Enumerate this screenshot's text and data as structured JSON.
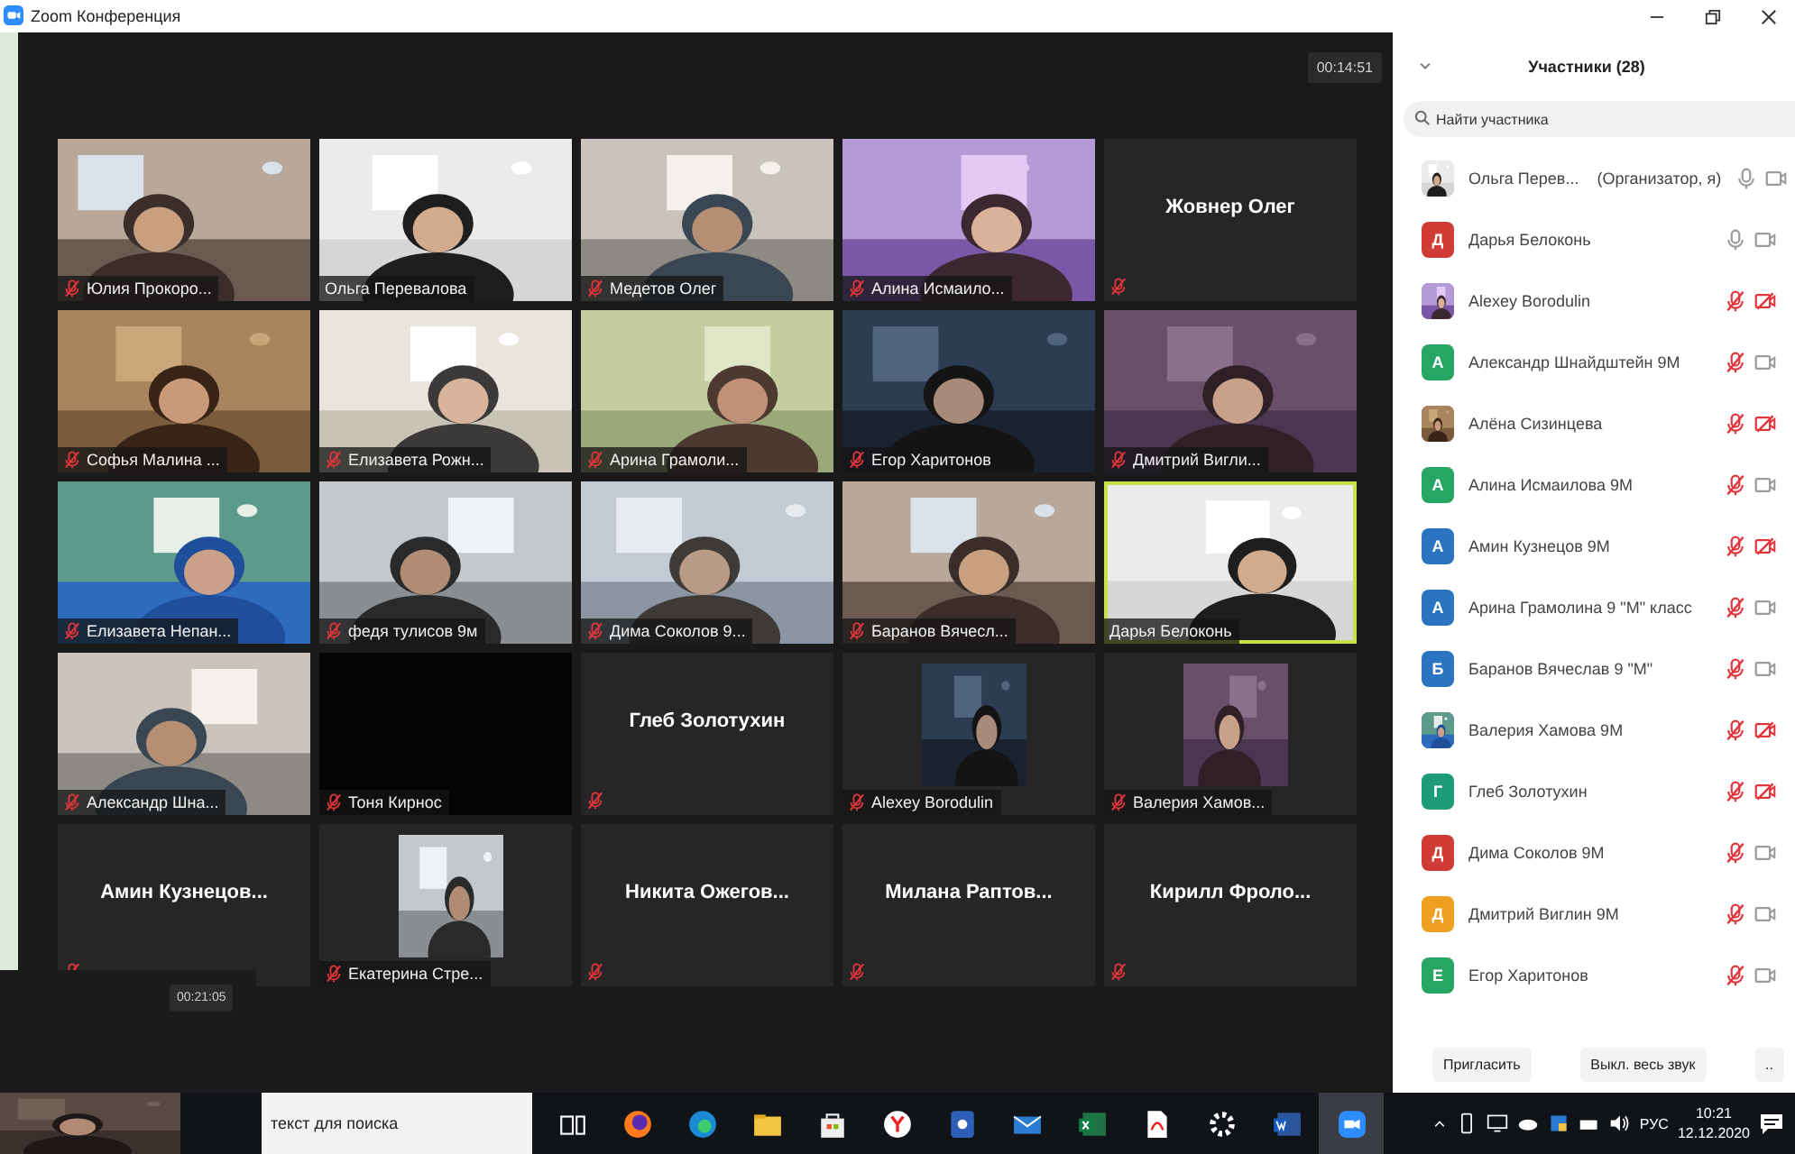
{
  "window": {
    "title": "Zoom Конференция"
  },
  "meeting_timer": "00:14:51",
  "tiles": [
    {
      "name": "Юлия Прокоро...",
      "kind": "video",
      "muted": true,
      "active": false
    },
    {
      "name": "Ольга Перевалова",
      "kind": "video",
      "muted": false,
      "active": false
    },
    {
      "name": "Медетов Олег",
      "kind": "video",
      "muted": true,
      "active": false
    },
    {
      "name": "Алина Исмаило...",
      "kind": "video",
      "muted": true,
      "active": false
    },
    {
      "name": "Жовнер Олег",
      "kind": "name_only",
      "muted": true,
      "active": false
    },
    {
      "name": "Софья Малина ...",
      "kind": "video",
      "muted": true,
      "active": false
    },
    {
      "name": "Елизавета Рожн...",
      "kind": "video",
      "muted": true,
      "active": false
    },
    {
      "name": "Арина Грамоли...",
      "kind": "video",
      "muted": true,
      "active": false
    },
    {
      "name": "Егор Харитонов",
      "kind": "video",
      "muted": true,
      "active": false
    },
    {
      "name": "Дмитрий Вигли...",
      "kind": "video",
      "muted": true,
      "active": false
    },
    {
      "name": "Елизавета Непан...",
      "kind": "video",
      "muted": true,
      "active": false
    },
    {
      "name": "федя тулисов 9м",
      "kind": "video",
      "muted": true,
      "active": false
    },
    {
      "name": "Дима Соколов 9...",
      "kind": "video",
      "muted": true,
      "active": false
    },
    {
      "name": "Баранов Вячесл...",
      "kind": "video",
      "muted": true,
      "active": false
    },
    {
      "name": "Дарья Белоконь",
      "kind": "video",
      "muted": false,
      "active": true
    },
    {
      "name": "Александр Шна...",
      "kind": "video",
      "muted": true,
      "active": false
    },
    {
      "name": "Тоня Кирнос",
      "kind": "dark",
      "muted": true,
      "active": false
    },
    {
      "name": "Глеб Золотухин",
      "kind": "name_only",
      "muted": true,
      "active": false
    },
    {
      "name": "Alexey Borodulin",
      "kind": "avatar",
      "muted": true,
      "active": false
    },
    {
      "name": "Валерия Хамов...",
      "kind": "avatar",
      "muted": true,
      "active": false
    },
    {
      "name": "Амин Кузнецов...",
      "kind": "name_only",
      "muted": true,
      "active": false
    },
    {
      "name": "Екатерина Стре...",
      "kind": "avatar",
      "muted": true,
      "active": false
    },
    {
      "name": "Никита Ожегов...",
      "kind": "name_only",
      "muted": true,
      "active": false
    },
    {
      "name": "Милана Раптов...",
      "kind": "name_only",
      "muted": true,
      "active": false
    },
    {
      "name": "Кирилл Фроло...",
      "kind": "name_only",
      "muted": true,
      "active": false
    }
  ],
  "second_window": {
    "timer": "00:21:05"
  },
  "participants_panel": {
    "title": "Участники (28)",
    "search": {
      "placeholder": "Найти участника"
    },
    "participants": [
      {
        "name": "Ольга Перев...",
        "role": "(Организатор, я)",
        "muted": false,
        "video_off": false
      },
      {
        "name": "Дарья Белоконь",
        "avatar": {
          "kind": "letter",
          "letter": "Д",
          "color": "#d13b35"
        },
        "muted": false,
        "video_off": false
      },
      {
        "name": "Alexey Borodulin",
        "muted": true,
        "video_off": true
      },
      {
        "name": "Александр Шнайдштейн 9М",
        "avatar": {
          "kind": "letter",
          "letter": "А",
          "color": "#27a563"
        },
        "muted": true,
        "video_off": false
      },
      {
        "name": "Алёна Сизинцева",
        "muted": true,
        "video_off": true
      },
      {
        "name": "Алина Исмаилова 9М",
        "avatar": {
          "kind": "letter",
          "letter": "А",
          "color": "#27a563"
        },
        "muted": true,
        "video_off": false
      },
      {
        "name": "Амин Кузнецов 9М",
        "avatar": {
          "kind": "letter",
          "letter": "А",
          "color": "#2b74c2"
        },
        "muted": true,
        "video_off": true
      },
      {
        "name": "Арина Грамолина 9 \"М\" класс",
        "avatar": {
          "kind": "letter",
          "letter": "А",
          "color": "#2b74c2"
        },
        "muted": true,
        "video_off": false
      },
      {
        "name": "Баранов Вячеслав 9 \"М\"",
        "avatar": {
          "kind": "letter",
          "letter": "Б",
          "color": "#2b74c2"
        },
        "muted": true,
        "video_off": false
      },
      {
        "name": "Валерия Хамова 9М",
        "muted": true,
        "video_off": true
      },
      {
        "name": "Глеб Золотухин",
        "avatar": {
          "kind": "letter",
          "letter": "Г",
          "color": "#1e9c78"
        },
        "muted": true,
        "video_off": true
      },
      {
        "name": "Дима Соколов 9М",
        "avatar": {
          "kind": "letter",
          "letter": "Д",
          "color": "#d13b35"
        },
        "muted": true,
        "video_off": false
      },
      {
        "name": "Дмитрий Виглин 9М",
        "avatar": {
          "kind": "letter",
          "letter": "Д",
          "color": "#f0a020"
        },
        "muted": true,
        "video_off": false
      },
      {
        "name": "Егор Харитонов",
        "avatar": {
          "kind": "letter",
          "letter": "Е",
          "color": "#27a563"
        },
        "muted": true,
        "video_off": false
      }
    ],
    "buttons": [
      "Пригласить",
      "Выкл. весь звук",
      ".."
    ]
  },
  "taskbar": {
    "search": {
      "value": "текст для поиска"
    },
    "language": "РУС",
    "time": "10:21",
    "date": "12.12.2020"
  }
}
